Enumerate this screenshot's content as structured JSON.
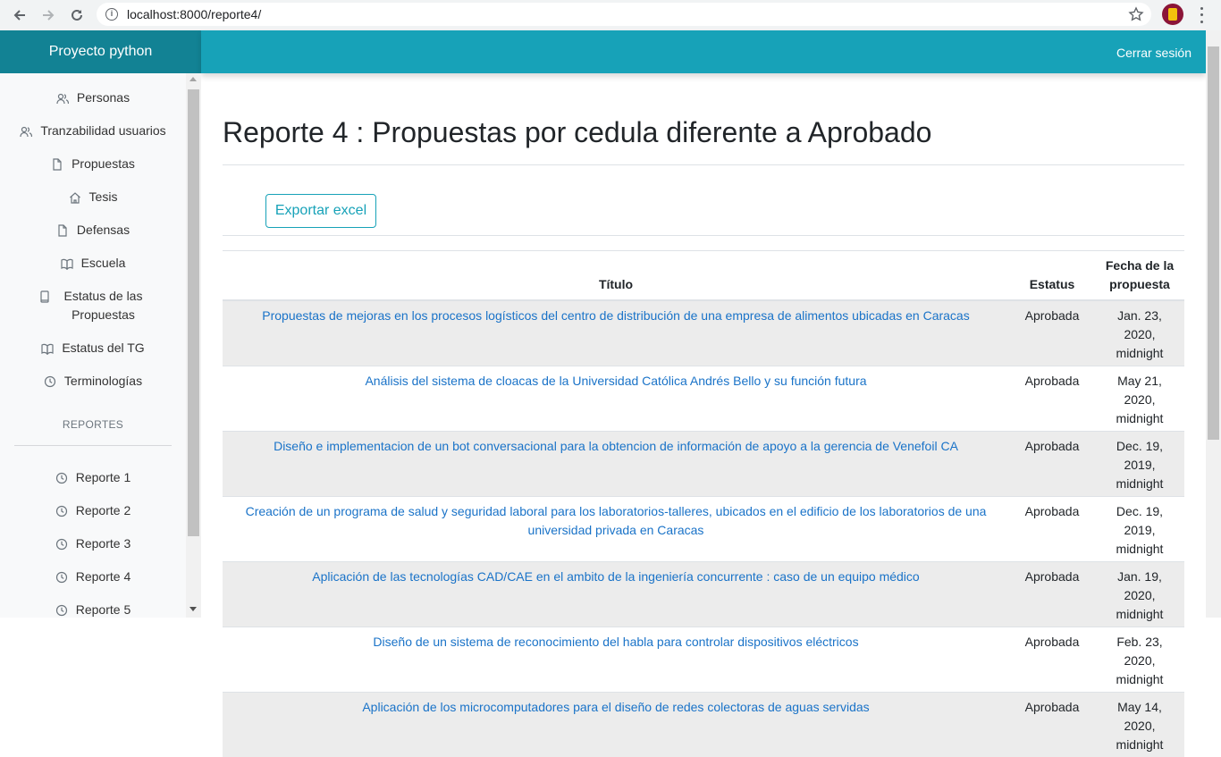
{
  "browser": {
    "url": "localhost:8000/reporte4/"
  },
  "brand": "Proyecto python",
  "header": {
    "logout": "Cerrar sesión"
  },
  "sidebar": {
    "items": [
      {
        "label": "Personas",
        "icon": "users-icon"
      },
      {
        "label": "Tranzabilidad usuarios",
        "icon": "users-icon"
      },
      {
        "label": "Propuestas",
        "icon": "file-icon"
      },
      {
        "label": "Tesis",
        "icon": "home-icon"
      },
      {
        "label": "Defensas",
        "icon": "file-icon"
      },
      {
        "label": "Escuela",
        "icon": "book-open-icon"
      },
      {
        "label": "Estatus de las Propuestas",
        "icon": "book-icon"
      },
      {
        "label": "Estatus del TG",
        "icon": "book-open-icon"
      },
      {
        "label": "Terminologías",
        "icon": "clock-icon"
      }
    ],
    "reports_heading": "REPORTES",
    "reports": [
      {
        "label": "Reporte 1",
        "icon": "clock-icon"
      },
      {
        "label": "Reporte 2",
        "icon": "clock-icon"
      },
      {
        "label": "Reporte 3",
        "icon": "clock-icon"
      },
      {
        "label": "Reporte 4",
        "icon": "clock-icon"
      },
      {
        "label": "Reporte 5",
        "icon": "clock-icon"
      }
    ]
  },
  "main": {
    "title": "Reporte 4 : Propuestas por cedula diferente a Aprobado",
    "export_label": "Exportar excel",
    "columns": {
      "title": "Título",
      "status": "Estatus",
      "date_line1": "Fecha de la",
      "date_line2": "propuesta"
    },
    "rows": [
      {
        "title": "Propuestas de mejoras en los procesos logísticos del centro de distribución de una empresa de alimentos ubicadas en Caracas",
        "status": "Aprobada",
        "date1": "Jan. 23, 2020,",
        "date2": "midnight"
      },
      {
        "title": "Análisis del sistema de cloacas de la Universidad Católica Andrés Bello y su función futura",
        "status": "Aprobada",
        "date1": "May 21, 2020,",
        "date2": "midnight"
      },
      {
        "title": "Diseño e implementacion de un bot conversacional para la obtencion de información de apoyo a la gerencia de Venefoil CA",
        "status": "Aprobada",
        "date1": "Dec. 19, 2019,",
        "date2": "midnight"
      },
      {
        "title": "Creación de un programa de salud y seguridad laboral para los laboratorios-talleres, ubicados en el edificio de los laboratorios de una universidad privada en Caracas",
        "status": "Aprobada",
        "date1": "Dec. 19, 2019,",
        "date2": "midnight"
      },
      {
        "title": "Aplicación de las tecnologías CAD/CAE en el ambito de la ingeniería concurrente : caso de un equipo médico",
        "status": "Aprobada",
        "date1": "Jan. 19, 2020,",
        "date2": "midnight"
      },
      {
        "title": "Diseño de un sistema de reconocimiento del habla para controlar dispositivos eléctricos",
        "status": "Aprobada",
        "date1": "Feb. 23, 2020,",
        "date2": "midnight"
      },
      {
        "title": "Aplicación de los microcomputadores para el diseño de redes colectoras de aguas servidas",
        "status": "Aprobada",
        "date1": "May 14, 2020,",
        "date2": "midnight"
      }
    ]
  },
  "colors": {
    "accent": "#17a2b8",
    "brand_bg": "#128294",
    "link": "#1a73c8"
  }
}
